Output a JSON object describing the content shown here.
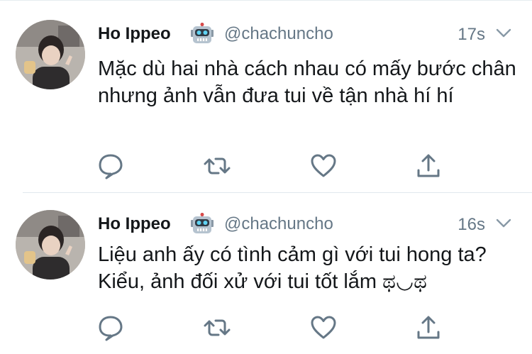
{
  "tweets": [
    {
      "display_name": "Ho Ippeo",
      "handle": "@chachuncho",
      "time": "17s",
      "text": "Mặc dù hai nhà cách nhau có mấy bước chân nhưng ảnh vẫn đưa tui về tận nhà hí hí",
      "badge_icon": "robot-emoji",
      "actions": [
        "reply-icon",
        "retweet-icon",
        "like-icon",
        "share-icon"
      ]
    },
    {
      "display_name": "Ho Ippeo",
      "handle": "@chachuncho",
      "time": "16s",
      "text": "Liệu anh ấy có tình cảm gì với tui hong ta? Kiểu, ảnh đối xử với tui tốt lắm ಥ◡ಥ",
      "badge_icon": "robot-emoji",
      "actions": [
        "reply-icon",
        "retweet-icon",
        "like-icon",
        "share-icon"
      ]
    }
  ],
  "colors": {
    "text": "#14171a",
    "secondary": "#657786",
    "icon": "#657786",
    "divider": "#e1e8ed"
  }
}
